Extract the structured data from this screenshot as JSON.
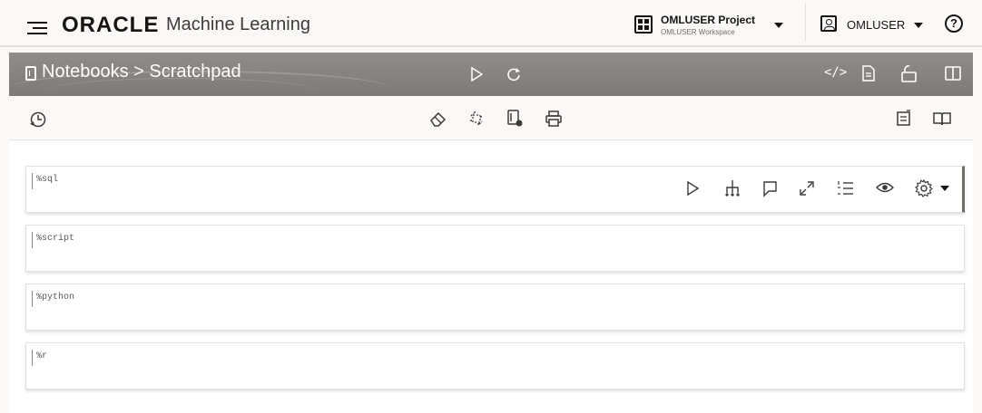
{
  "header": {
    "logo_text": "ORACLE",
    "app_name": "Machine Learning",
    "project_name": "OMLUSER Project",
    "workspace_name": "OMLUSER Workspace",
    "user_name": "OMLUSER",
    "help_glyph": "?"
  },
  "notebook_bar": {
    "breadcrumb": "Notebooks > Scratchpad",
    "icons": [
      "notebook-icon",
      "run-icon",
      "refresh-icon",
      "code-icon",
      "document-icon",
      "lock-open-icon",
      "split-panel-icon"
    ],
    "code_glyph": "</>"
  },
  "toolbar": {
    "icons": [
      "history-icon",
      "clear-output-icon",
      "invalidate-icon",
      "notebook-settings-icon",
      "print-icon",
      "show-hide-code-icon",
      "book-icon"
    ]
  },
  "cells": [
    {
      "code": "%sql",
      "active": true
    },
    {
      "code": "%script",
      "active": false
    },
    {
      "code": "%python",
      "active": false
    },
    {
      "code": "%r",
      "active": false
    }
  ],
  "cell_tools": {
    "icons": [
      "run-paragraph-icon",
      "hierarchy-icon",
      "comment-icon",
      "expand-icon",
      "line-numbers-icon",
      "eye-icon",
      "gear-icon"
    ]
  },
  "colors": {
    "band": "#8f8c89",
    "background": "#fbf9f8",
    "text": "#161513"
  }
}
